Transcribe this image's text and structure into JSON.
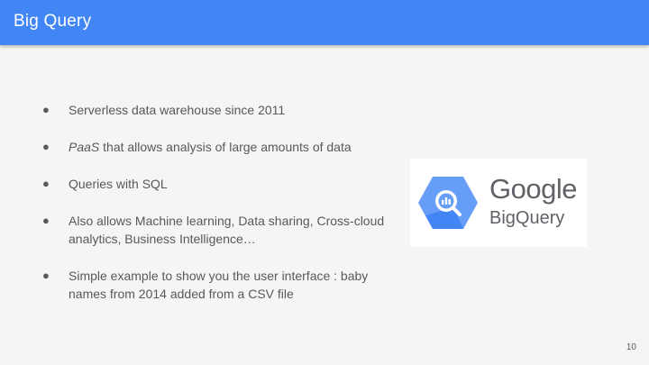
{
  "header": {
    "title": "Big Query"
  },
  "bullets": [
    {
      "lead_italic": "",
      "text": "Serverless data warehouse since 2011"
    },
    {
      "lead_italic": "PaaS",
      "text": " that allows analysis of large amounts of data"
    },
    {
      "lead_italic": "",
      "text": "Queries with SQL"
    },
    {
      "lead_italic": "",
      "text": "Also allows Machine learning, Data sharing, Cross-cloud analytics, Business Intelligence…"
    },
    {
      "lead_italic": "",
      "text": "Simple example to show you the user interface : baby names from 2014 added from a CSV file"
    }
  ],
  "bullet_glyph": "●",
  "logo": {
    "brand": "Google",
    "product": "BigQuery",
    "icon": "bigquery-magnifier-icon",
    "colors": {
      "hex_light": "#669df6",
      "hex_dark": "#4285f4",
      "text": "#5f6368"
    }
  },
  "page_number": "10",
  "colors": {
    "header_bg": "#4285f4",
    "body_bg": "#f5f5f5",
    "text": "#595959"
  }
}
